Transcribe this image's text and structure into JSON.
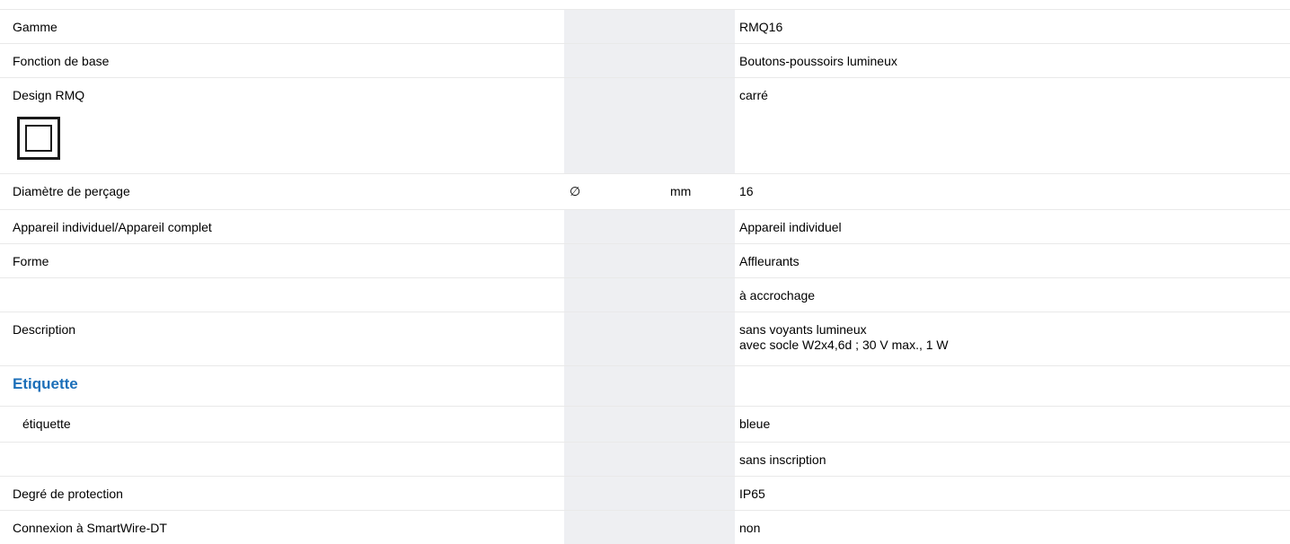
{
  "rows": [
    {
      "label": "Gamme",
      "symbol": "",
      "unit": "",
      "value": "RMQ16"
    },
    {
      "label": "Fonction de base",
      "symbol": "",
      "unit": "",
      "value": "Boutons-poussoirs lumineux"
    },
    {
      "label": "Design RMQ",
      "symbol": "",
      "unit": "",
      "value": "carré",
      "icon": "square-design-icon"
    },
    {
      "label": "Diamètre de perçage",
      "symbol": "∅",
      "unit": "mm",
      "value": "16"
    },
    {
      "label": "Appareil individuel/Appareil complet",
      "symbol": "",
      "unit": "",
      "value": "Appareil individuel"
    },
    {
      "label": "Forme",
      "symbol": "",
      "unit": "",
      "value": "Affleurants"
    },
    {
      "label": "",
      "symbol": "",
      "unit": "",
      "value": "à accrochage"
    },
    {
      "label": "Description",
      "symbol": "",
      "unit": "",
      "value_lines": [
        "sans voyants lumineux",
        "avec socle W2x4,6d ; 30 V max., 1 W"
      ]
    },
    {
      "label": "Etiquette",
      "symbol": "",
      "unit": "",
      "value": "",
      "section": true
    },
    {
      "label": "étiquette",
      "symbol": "",
      "unit": "",
      "value": "bleue"
    },
    {
      "label": "",
      "symbol": "",
      "unit": "",
      "value": "sans inscription"
    },
    {
      "label": "Degré de protection",
      "symbol": "",
      "unit": "",
      "value": "IP65"
    },
    {
      "label": "Connexion à SmartWire-DT",
      "symbol": "",
      "unit": "",
      "value": "non"
    }
  ],
  "colors": {
    "section_heading": "#1c6fb9",
    "column_shade": "#eeeff2"
  }
}
